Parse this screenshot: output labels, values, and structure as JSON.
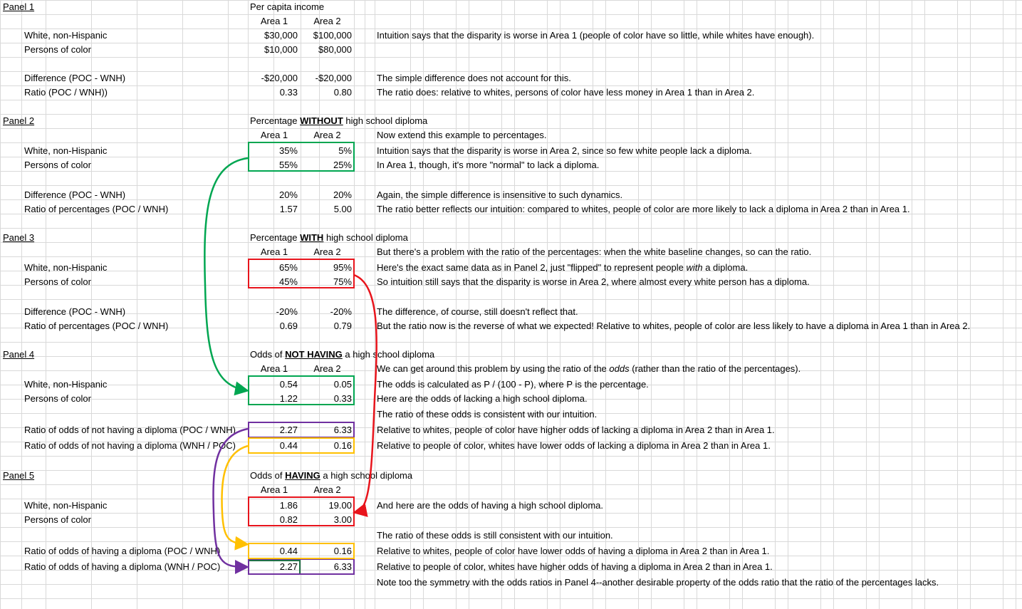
{
  "colors": {
    "green": "#00a651",
    "red": "#e8141c",
    "purple": "#7030a0",
    "yellow": "#ffc000",
    "grid": "#d9d9d9"
  },
  "panel1": {
    "label": "Panel 1",
    "title": "Per capita income",
    "area1": "Area 1",
    "area2": "Area 2",
    "r1_label": "White, non-Hispanic",
    "r1_a1": "$30,000",
    "r1_a2": "$100,000",
    "r1_note": "Intuition says that the disparity is worse in Area 1 (people of color have so little, while whites have enough).",
    "r2_label": "Persons of color",
    "r2_a1": "$10,000",
    "r2_a2": "$80,000",
    "r3_label": "Difference (POC - WNH)",
    "r3_a1": "-$20,000",
    "r3_a2": "-$20,000",
    "r3_note": "The simple difference does not account for this.",
    "r4_label": "Ratio (POC / WNH))",
    "r4_a1": "0.33",
    "r4_a2": "0.80",
    "r4_note": "The ratio does: relative to whites, persons of color have less money in Area 1 than in Area 2."
  },
  "panel2": {
    "label": "Panel 2",
    "title_pre": "Percentage ",
    "title_em": "WITHOUT",
    "title_post": " high school diploma",
    "area1": "Area 1",
    "area2": "Area 2",
    "hdr_note": "Now extend this example to percentages.",
    "r1_label": "White, non-Hispanic",
    "r1_a1": "35%",
    "r1_a2": "5%",
    "r1_note": "Intuition says that the disparity is worse in Area 2, since so few white people lack a diploma.",
    "r2_label": "Persons of color",
    "r2_a1": "55%",
    "r2_a2": "25%",
    "r2_note": "In Area 1, though, it's more \"normal\" to lack a diploma.",
    "r3_label": "Difference (POC - WNH)",
    "r3_a1": "20%",
    "r3_a2": "20%",
    "r3_note": "Again, the simple difference is insensitive to such dynamics.",
    "r4_label": "Ratio of percentages (POC / WNH)",
    "r4_a1": "1.57",
    "r4_a2": "5.00",
    "r4_note": "The ratio better reflects our intuition: compared to whites, people of color are more likely to lack a diploma in Area 2 than in Area 1."
  },
  "panel3": {
    "label": "Panel 3",
    "title_pre": "Percentage ",
    "title_em": "WITH",
    "title_post": " high school diploma",
    "area1": "Area 1",
    "area2": "Area 2",
    "hdr_note": "But there's a problem with the ratio of the percentages: when the white baseline changes, so can the ratio.",
    "r1_label": "White, non-Hispanic",
    "r1_a1": "65%",
    "r1_a2": "95%",
    "r1_note_pre": "Here's the exact same data as in Panel 2, just \"flipped\" to represent people ",
    "r1_note_em": "with",
    "r1_note_post": "  a diploma.",
    "r2_label": "Persons of color",
    "r2_a1": "45%",
    "r2_a2": "75%",
    "r2_note": "So intuition still says that the disparity is worse in Area 2, where almost every white person has a diploma.",
    "r3_label": "Difference (POC - WNH)",
    "r3_a1": "-20%",
    "r3_a2": "-20%",
    "r3_note": "The difference, of course, still doesn't reflect that.",
    "r4_label": "Ratio of percentages (POC / WNH)",
    "r4_a1": "0.69",
    "r4_a2": "0.79",
    "r4_note": "But the ratio now is the reverse of what we expected! Relative to whites, people of color are less likely to have a diploma in Area 1 than in Area 2."
  },
  "panel4": {
    "label": "Panel 4",
    "title_pre": "Odds of ",
    "title_em": "NOT HAVING",
    "title_post": " a high school diploma",
    "area1": "Area 1",
    "area2": "Area 2",
    "hdr_note_pre": "We can get around this problem by using the ratio of the ",
    "hdr_note_em": "odds",
    "hdr_note_post": "  (rather than the ratio of the percentages).",
    "r1_label": "White, non-Hispanic",
    "r1_a1": "0.54",
    "r1_a2": "0.05",
    "r1_note": "The odds is calculated as P / (100 - P), where P is the percentage.",
    "r2_label": "Persons of color",
    "r2_a1": "1.22",
    "r2_a2": "0.33",
    "r2_note": "Here are the odds of lacking a high school diploma.",
    "gap_note": "The ratio of these odds is consistent with our intuition.",
    "r3_label": "Ratio of odds of not having a diploma (POC / WNH)",
    "r3_a1": "2.27",
    "r3_a2": "6.33",
    "r3_note": "Relative to whites, people of color have higher odds of lacking a diploma in Area 2 than in Area 1.",
    "r4_label": "Ratio of odds of not having a diploma (WNH / POC)",
    "r4_a1": "0.44",
    "r4_a2": "0.16",
    "r4_note": "Relative to people of color, whites have lower odds of lacking a diploma in Area 2 than in Area 1."
  },
  "panel5": {
    "label": "Panel 5",
    "title_pre": "Odds of ",
    "title_em": "HAVING",
    "title_post": " a high school diploma",
    "area1": "Area 1",
    "area2": "Area 2",
    "r1_label": "White, non-Hispanic",
    "r1_a1": "1.86",
    "r1_a2": "19.00",
    "r1_note": "And here are the odds of having a high school diploma.",
    "r2_label": "Persons of color",
    "r2_a1": "0.82",
    "r2_a2": "3.00",
    "gap_note": "The ratio of these odds is still consistent with our intuition.",
    "r3_label": "Ratio of odds of having a diploma (POC / WNH)",
    "r3_a1": "0.44",
    "r3_a2": "0.16",
    "r3_note": "Relative to whites, people of color have lower odds of having a diploma in Area 2 than in Area 1.",
    "r4_label": "Ratio of odds of having a diploma (WNH / POC)",
    "r4_a1": "2.27",
    "r4_a2": "6.33",
    "r4_note": "Relative to people of color, whites have higher odds of having a diploma in Area 2 than in Area 1.",
    "final_note": "Note too the symmetry with the odds ratios in Panel 4--another desirable property of the odds ratio that the ratio of the percentages lacks."
  }
}
